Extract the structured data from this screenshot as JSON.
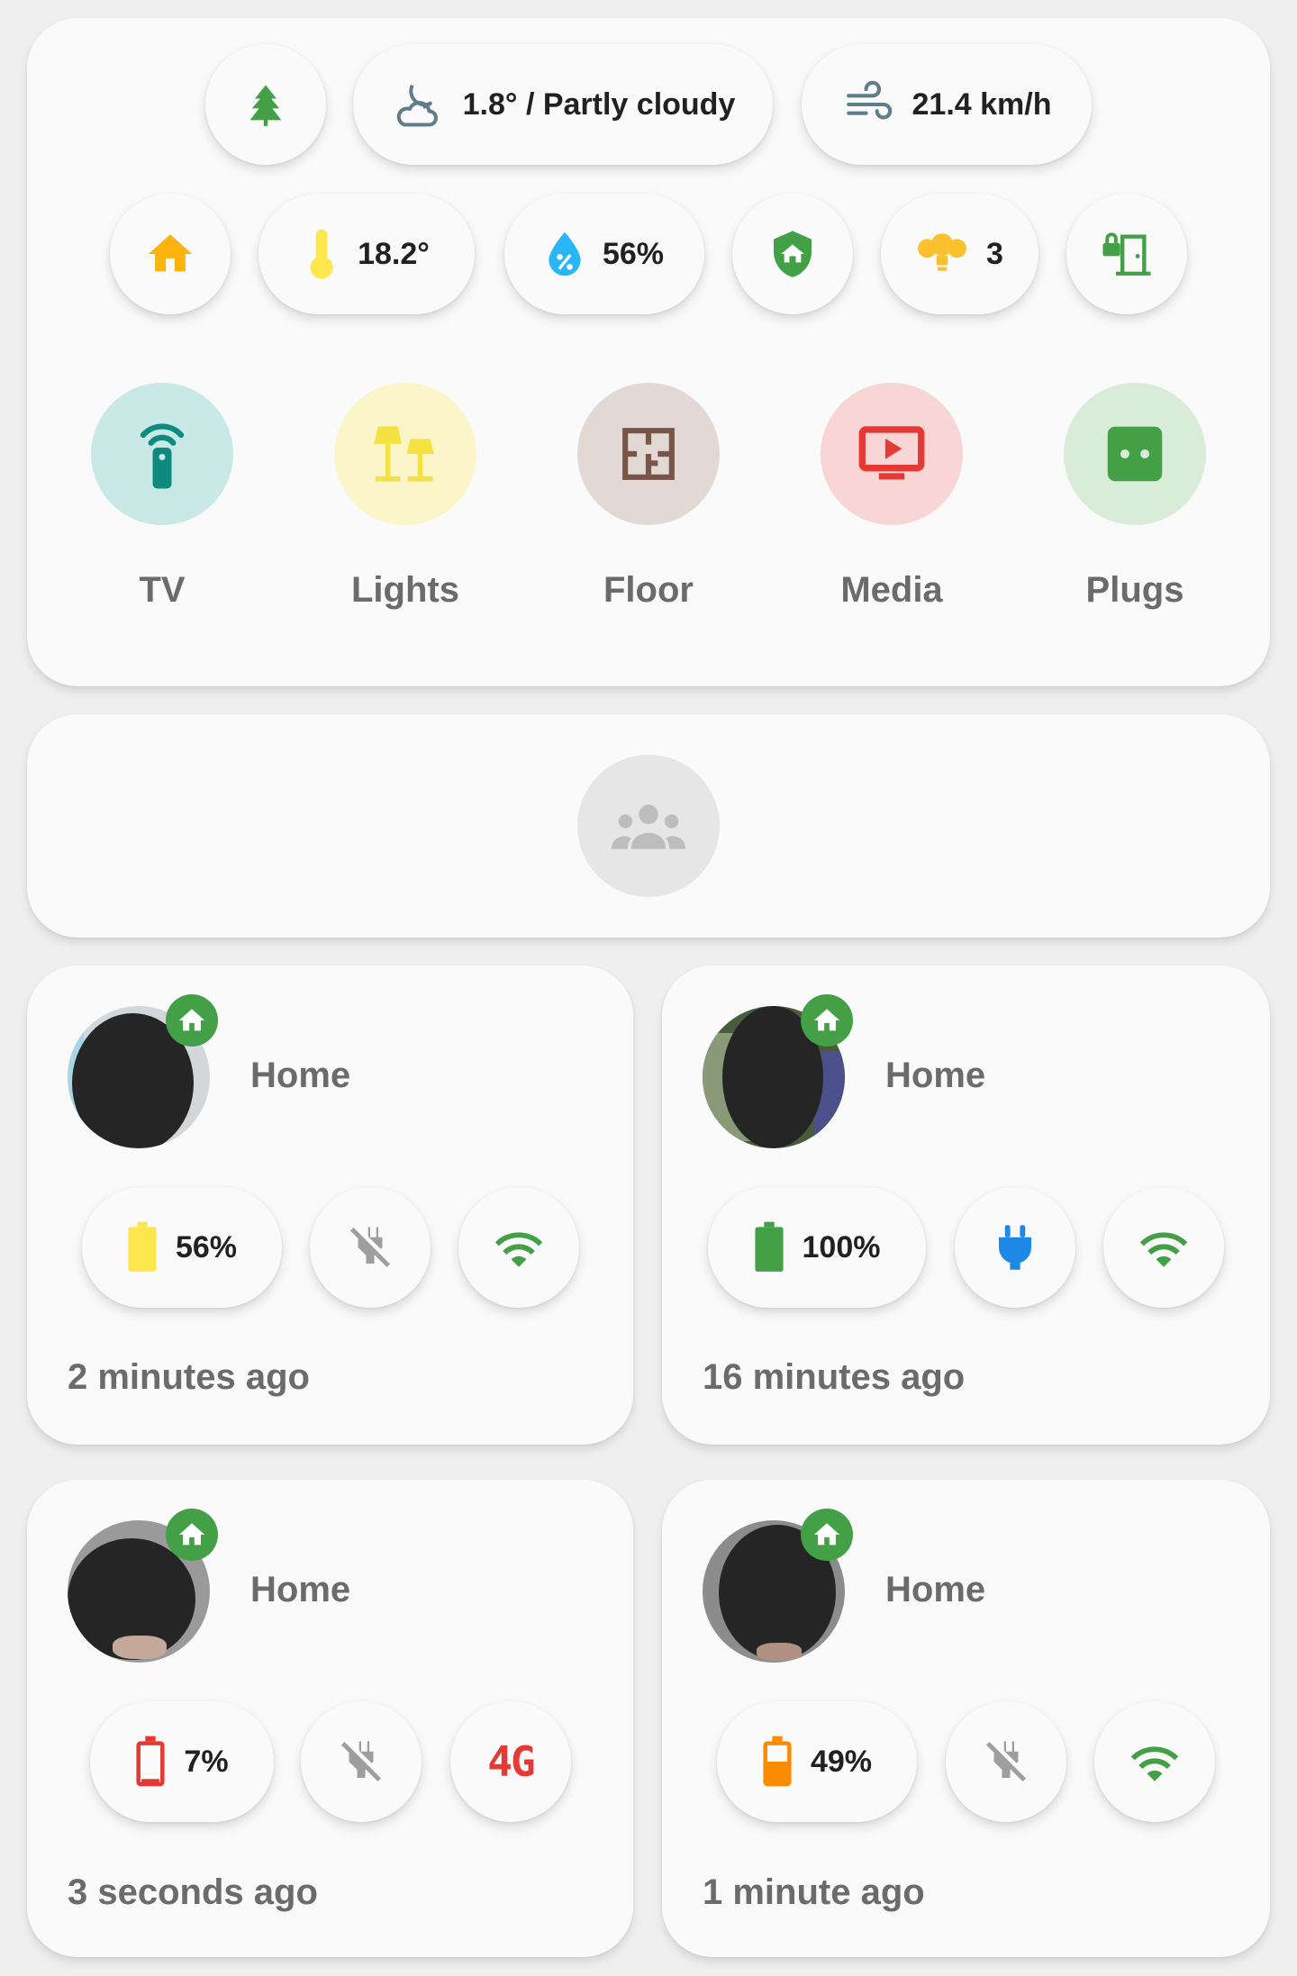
{
  "weather": {
    "condition": "1.8° / Partly cloudy",
    "wind": "21.4 km/h",
    "season_icon": "pine-tree-icon",
    "condition_icon": "weather-night-partly-cloudy-icon",
    "wind_icon": "weather-windy-icon"
  },
  "status": {
    "temperature": "18.2°",
    "humidity": "56%",
    "lights_on": "3",
    "colors": {
      "home": "#fbb40f",
      "temperature": "#fde74c",
      "humidity": "#29b6f6",
      "security": "#43a047",
      "lights": "#fbc02d",
      "door": "#43a047"
    }
  },
  "nav": [
    {
      "label": "TV",
      "icon": "remote-tv-icon",
      "bg": "#c9e9e6",
      "fg": "#0e8a7e"
    },
    {
      "label": "Lights",
      "icon": "lamps-icon",
      "bg": "#fbf5c9",
      "fg": "#f6e142"
    },
    {
      "label": "Floor",
      "icon": "floor-plan-icon",
      "bg": "#e2d9d5",
      "fg": "#795548"
    },
    {
      "label": "Media",
      "icon": "television-play-icon",
      "bg": "#f8d6d6",
      "fg": "#e53935"
    },
    {
      "label": "Plugs",
      "icon": "power-socket-icon",
      "bg": "#d9ecd8",
      "fg": "#43a047"
    }
  ],
  "people_group": {
    "icon": "account-group-icon"
  },
  "persons": [
    {
      "zone": "Home",
      "battery": "56%",
      "battery_color": "#fde74c",
      "battery_level": 0.56,
      "charging": false,
      "connection": "wifi",
      "updated": "2 minutes ago"
    },
    {
      "zone": "Home",
      "battery": "100%",
      "battery_color": "#43a047",
      "battery_level": 1.0,
      "charging": true,
      "connection": "wifi",
      "updated": "16 minutes ago"
    },
    {
      "zone": "Home",
      "battery": "7%",
      "battery_color": "#e53935",
      "battery_level": 0.07,
      "charging": false,
      "connection": "4G",
      "updated": "3 seconds ago"
    },
    {
      "zone": "Home",
      "battery": "49%",
      "battery_color": "#fb8c00",
      "battery_level": 0.49,
      "charging": false,
      "connection": "wifi",
      "updated": "1 minute ago"
    }
  ]
}
